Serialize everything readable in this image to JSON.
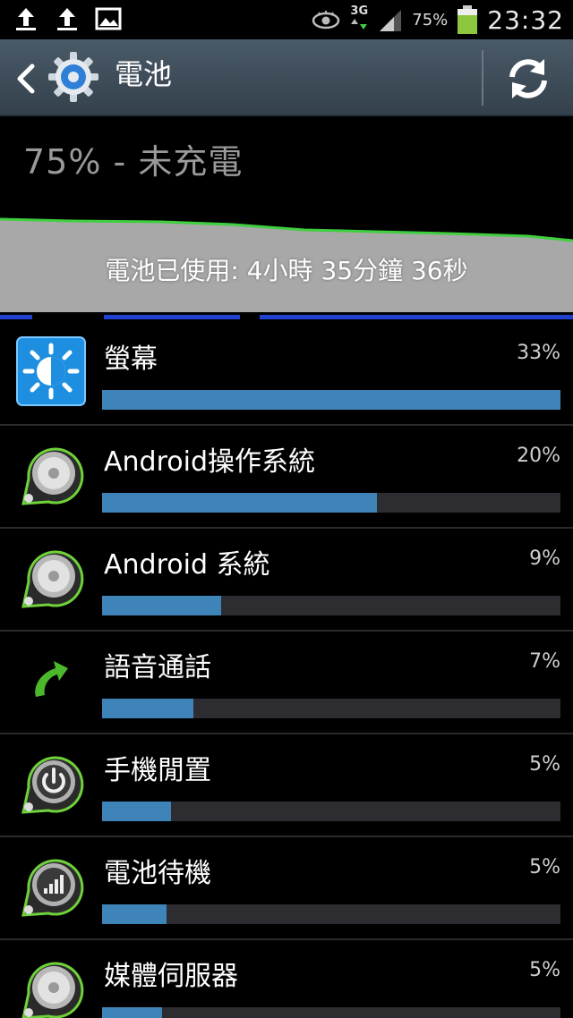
{
  "status_bar": {
    "network": "3G",
    "battery_percent": "75%",
    "time": "23:32"
  },
  "action_bar": {
    "title": "電池"
  },
  "battery": {
    "status": "75% - 未充電",
    "usage_text": "電池已使用: 4小時 35分鐘 36秒"
  },
  "items": [
    {
      "label": "螢幕",
      "percent": "33%",
      "fraction": 1.0,
      "icon": "screen-brightness-icon"
    },
    {
      "label": "Android操作系統",
      "percent": "20%",
      "fraction": 0.6,
      "icon": "android-os-icon"
    },
    {
      "label": "Android 系統",
      "percent": "9%",
      "fraction": 0.26,
      "icon": "android-system-icon"
    },
    {
      "label": "語音通話",
      "percent": "7%",
      "fraction": 0.2,
      "icon": "phone-call-icon"
    },
    {
      "label": "手機閒置",
      "percent": "5%",
      "fraction": 0.15,
      "icon": "power-idle-icon"
    },
    {
      "label": "電池待機",
      "percent": "5%",
      "fraction": 0.14,
      "icon": "signal-standby-icon"
    },
    {
      "label": "媒體伺服器",
      "percent": "5%",
      "fraction": 0.13,
      "icon": "media-server-icon"
    }
  ]
}
